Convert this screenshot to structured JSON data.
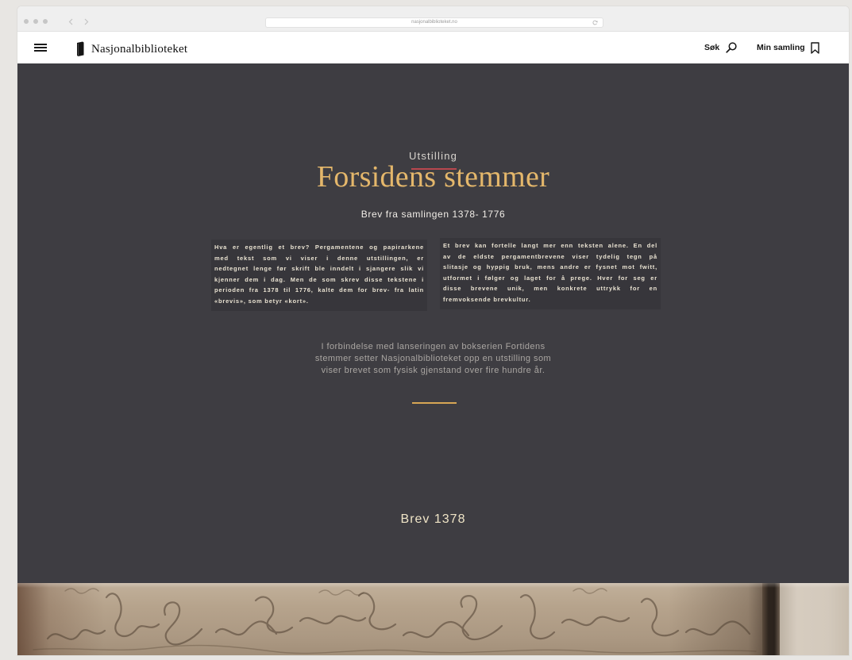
{
  "browser": {
    "url": "nasjonalbiblioteket.no"
  },
  "header": {
    "logo_text": "Nasjonalbiblioteket",
    "search_label": "Søk",
    "collection_label": "Min samling"
  },
  "hero": {
    "eyebrow": "Utstilling",
    "title": "Forsidens stemmer",
    "subtitle": "Brev fra samlingen 1378- 1776",
    "left_column": [
      "Hva er egentlig et brev? Pergamentene og papirarkene",
      "med tekst som vi viser i denne utstillingen, er",
      "nedtegnet lenge før skrift ble inndelt i sjangere slik vi",
      "kjenner dem i dag. Men de som skrev disse tekstene i",
      "perioden fra 1378 til 1776, kalte dem for brev- fra latin",
      "«brevis», som betyr «kort»."
    ],
    "right_column": [
      "Et brev kan fortelle langt mer enn teksten alene. En del",
      "av de eldste pergamentbrevene viser tydelig tegn på",
      "slitasje og hyppig bruk, mens andre er fysnet mot fwitt,",
      "utformet i følger og laget for å prege. Hver for seg er",
      "disse brevene unik, men konkrete uttrykk for en",
      "fremvoksende brevkultur."
    ],
    "lead": [
      "I forbindelse med lanseringen av bokserien Fortidens",
      "stemmer setter Nasjonalbiblioteket opp en utstilling som",
      "viser brevet som fysisk gjenstand over fire hundre år."
    ],
    "section_heading": "Brev 1378"
  },
  "colors": {
    "hero_background": "#3e3d42",
    "title_gold": "#e4b76b",
    "eyebrow_rule": "#b9474f",
    "divider_gold": "#d7a655"
  },
  "icons": {
    "menu": "hamburger-icon",
    "logo": "book-icon",
    "search": "search-icon",
    "collection": "bookmark-icon",
    "back": "chevron-left-icon",
    "forward": "chevron-right-icon",
    "reload": "reload-icon"
  }
}
